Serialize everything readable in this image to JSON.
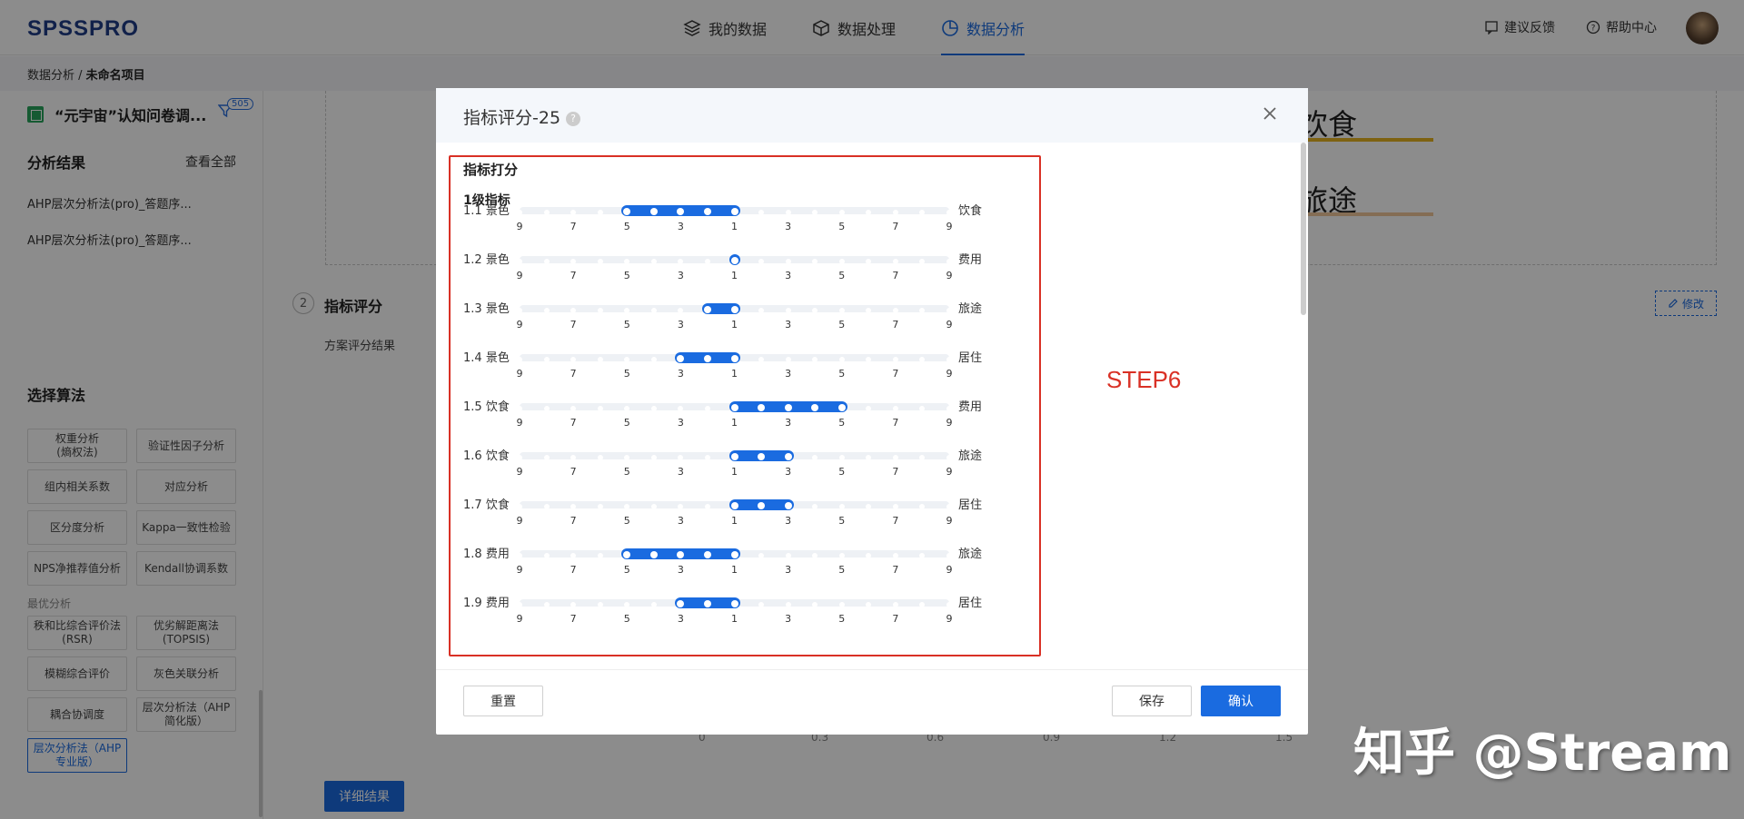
{
  "app": {
    "logo": "SPSSPRO"
  },
  "nav": {
    "items": [
      {
        "label": "我的数据",
        "icon": "layers-icon"
      },
      {
        "label": "数据处理",
        "icon": "cube-icon"
      },
      {
        "label": "数据分析",
        "icon": "pie-icon",
        "active": true
      }
    ]
  },
  "tools": {
    "feedback": "建议反馈",
    "help": "帮助中心"
  },
  "breadcrumb": {
    "parent": "数据分析 /",
    "current": "未命名项目"
  },
  "sidebar": {
    "file_name": "“元宇宙”认知问卷调...",
    "filter_badge": "505",
    "results_title": "分析结果",
    "view_all": "查看全部",
    "results": [
      "AHP层次分析法(pro)_答题序...",
      "AHP层次分析法(pro)_答题序..."
    ],
    "algo_title": "选择算法",
    "algos_a": [
      [
        "权重分析\n(熵权法)",
        "验证性因子分析"
      ],
      [
        "组内相关系数",
        "对应分析"
      ],
      [
        "区分度分析",
        "Kappa一致性检验"
      ],
      [
        "NPS净推荐值分析",
        "Kendall协调系数"
      ]
    ],
    "category": "最优分析",
    "algos_b": [
      [
        "秩和比综合评价法\n(RSR)",
        "优劣解距离法\n(TOPSIS)"
      ],
      [
        "模糊综合评价",
        "灰色关联分析"
      ],
      [
        "耦合协调度",
        "层次分析法（AHP\n简化版）"
      ]
    ],
    "algo_selected": "层次分析法（AHP\n专业版）"
  },
  "main": {
    "word1": "饮食",
    "word2": "旅途",
    "step_num": "2",
    "step_title": "指标评分",
    "plan_result": "方案评分结果",
    "modify": "修改",
    "axis_ticks": [
      "0",
      "0.3",
      "0.6",
      "0.9",
      "1.2",
      "1.5"
    ],
    "detail_btn": "详细结果"
  },
  "modal": {
    "title": "指标评分-25",
    "help": "?",
    "section": "指标打分",
    "level": "1级指标",
    "ticks": [
      "9",
      "7",
      "5",
      "3",
      "1",
      "3",
      "5",
      "7",
      "9"
    ],
    "rows": [
      {
        "id": "1.1",
        "left": "景色",
        "right": "饮食",
        "from": 5,
        "to": 1
      },
      {
        "id": "1.2",
        "left": "景色",
        "right": "费用",
        "from": 1,
        "to": 1
      },
      {
        "id": "1.3",
        "left": "景色",
        "right": "旅途",
        "from": 2,
        "to": 1
      },
      {
        "id": "1.4",
        "left": "景色",
        "right": "居住",
        "from": 3,
        "to": 1
      },
      {
        "id": "1.5",
        "left": "饮食",
        "right": "费用",
        "from": 1,
        "to": -5
      },
      {
        "id": "1.6",
        "left": "饮食",
        "right": "旅途",
        "from": 1,
        "to": -3
      },
      {
        "id": "1.7",
        "left": "饮食",
        "right": "居住",
        "from": 1,
        "to": -3
      },
      {
        "id": "1.8",
        "left": "费用",
        "right": "旅途",
        "from": 5,
        "to": 1
      },
      {
        "id": "1.9",
        "left": "费用",
        "right": "居住",
        "from": 3,
        "to": 1
      }
    ],
    "annotation": "STEP6",
    "reset": "重置",
    "save": "保存",
    "confirm": "确认"
  },
  "watermark": "知乎 @Stream"
}
